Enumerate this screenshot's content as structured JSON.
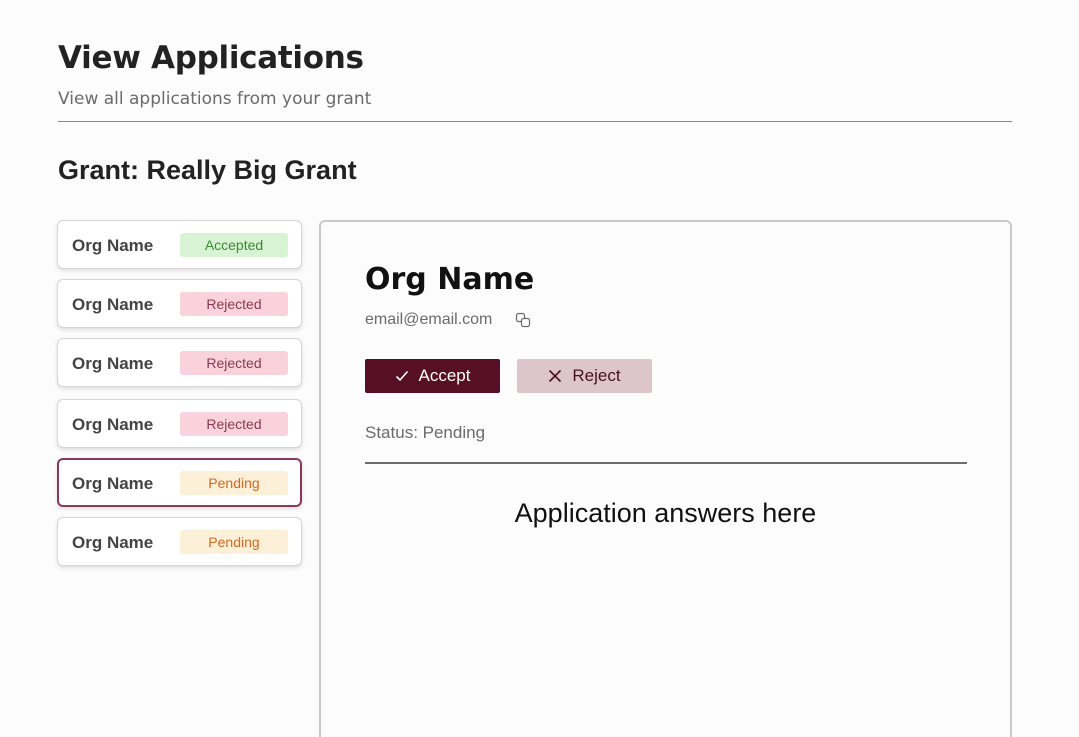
{
  "header": {
    "title": "View Applications",
    "subtitle": "View all applications from your grant"
  },
  "grant": {
    "heading": "Grant: Really Big Grant"
  },
  "applications": [
    {
      "org": "Org Name",
      "status": "Accepted",
      "selected": false
    },
    {
      "org": "Org Name",
      "status": "Rejected",
      "selected": false
    },
    {
      "org": "Org Name",
      "status": "Rejected",
      "selected": false
    },
    {
      "org": "Org Name",
      "status": "Rejected",
      "selected": false
    },
    {
      "org": "Org Name",
      "status": "Pending",
      "selected": true
    },
    {
      "org": "Org Name",
      "status": "Pending",
      "selected": false
    }
  ],
  "detail": {
    "org": "Org Name",
    "email": "email@email.com",
    "accept_label": "Accept",
    "reject_label": "Reject",
    "status": "Status: Pending",
    "answers_placeholder": "Application answers here"
  },
  "icons": {
    "copy": "copy-icon",
    "accept": "check-icon",
    "reject": "close-icon"
  },
  "colors": {
    "accent": "#560f24",
    "reject_button": "#dcc6cb",
    "selected_border": "#8c3a52",
    "accepted_badge_bg": "#d8f2d4",
    "accepted_badge_text": "#3d8a33",
    "rejected_badge_bg": "#fad2de",
    "rejected_badge_text": "#8a3a50",
    "pending_badge_bg": "#fdf0d8",
    "pending_badge_text": "#d8681e"
  }
}
